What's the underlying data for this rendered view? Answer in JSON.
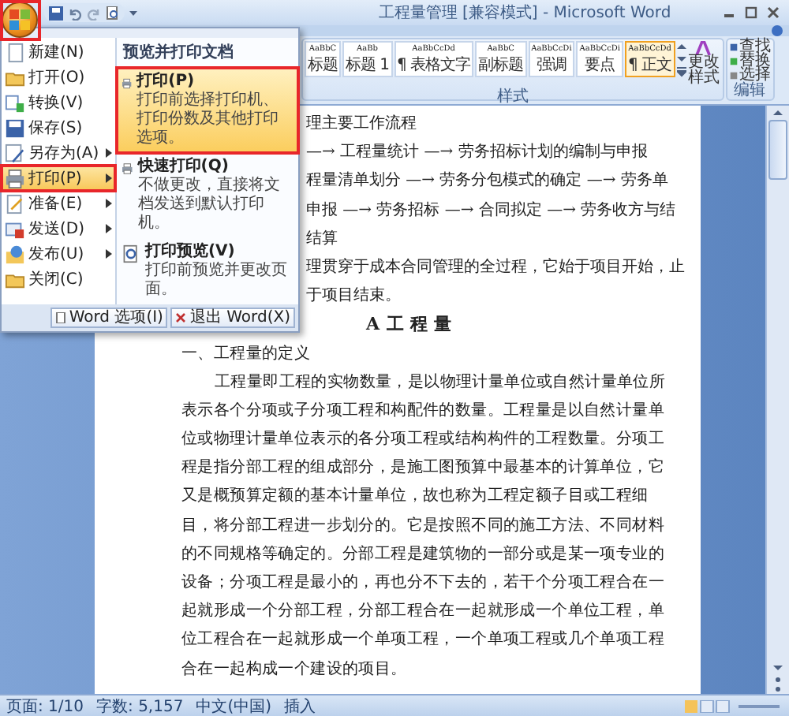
{
  "window": {
    "title": "工程量管理 [兼容模式] - Microsoft Word"
  },
  "ribbon": {
    "styles": [
      {
        "sample": "AaBbC",
        "label": "标题",
        "selected": false
      },
      {
        "sample": "AaBb",
        "label": "标题 1",
        "selected": false
      },
      {
        "sample": "AaBbCcDd",
        "label": "¶ 表格文字",
        "selected": false
      },
      {
        "sample": "AaBbC",
        "label": "副标题",
        "selected": false
      },
      {
        "sample": "AaBbCcDi",
        "label": "强调",
        "selected": false
      },
      {
        "sample": "AaBbCcDi",
        "label": "要点",
        "selected": false
      },
      {
        "sample": "AaBbCcDd",
        "label": "¶ 正文",
        "selected": true
      }
    ],
    "change_styles": "更改样式",
    "styles_group": "样式",
    "editing": [
      {
        "label": "查找"
      },
      {
        "label": "替换"
      },
      {
        "label": "选择"
      }
    ],
    "editing_group": "编辑"
  },
  "office_menu": {
    "items": [
      {
        "label": "新建(N)",
        "submenu": false,
        "selected": false
      },
      {
        "label": "打开(O)",
        "submenu": false,
        "selected": false
      },
      {
        "label": "转换(V)",
        "submenu": false,
        "selected": false
      },
      {
        "label": "保存(S)",
        "submenu": false,
        "selected": false
      },
      {
        "label": "另存为(A)",
        "submenu": true,
        "selected": false
      },
      {
        "label": "打印(P)",
        "submenu": true,
        "selected": true
      },
      {
        "label": "准备(E)",
        "submenu": true,
        "selected": false
      },
      {
        "label": "发送(D)",
        "submenu": true,
        "selected": false
      },
      {
        "label": "发布(U)",
        "submenu": true,
        "selected": false
      },
      {
        "label": "关闭(C)",
        "submenu": false,
        "selected": false
      }
    ],
    "panel": {
      "title": "预览并打印文档",
      "options": [
        {
          "label": "打印(P)",
          "description": "打印前选择打印机、打印份数及其他打印选项。",
          "selected": true
        },
        {
          "label": "快速打印(Q)",
          "description": "不做更改，直接将文档发送到默认打印机。",
          "selected": false
        },
        {
          "label": "打印预览(V)",
          "description": "打印前预览并更改页面。",
          "selected": false
        }
      ]
    },
    "footer_buttons": [
      "Word 选项(I)",
      "退出 Word(X)"
    ]
  },
  "document": {
    "flow_lines": [
      "理主要工作流程",
      "—→ 工程量统计 —→ 劳务招标计划的编制与申报",
      "程量清单划分 —→ 劳务分包模式的确定 —→ 劳务单",
      "申报 —→ 劳务招标 —→ 合同拟定 —→ 劳务收方与结",
      "结算",
      "理贯穿于成本合同管理的全过程，它始于项目开始，止",
      "于项目结束。"
    ],
    "heading": "A 工 程 量",
    "section": "一、工程量的定义",
    "paragraph_lines": [
      "工程量即工程的实物数量，是以物理计量单位或自然计量单位所",
      "表示各个分项或子分项工程和构配件的数量。工程量是以自然计量单",
      "位或物理计量单位表示的各分项工程或结构构件的工程数量。分项工",
      "程是指分部工程的组成部分，是施工图预算中最基本的计算单位，它",
      "又是概预算定额的基本计量单位，故也称为工程定额子目或工程细",
      "目，将分部工程进一步划分的。它是按照不同的施工方法、不同材料",
      "的不同规格等确定的。分部工程是建筑物的一部分或是某一项专业的",
      "设备；分项工程是最小的，再也分不下去的，若干个分项工程合在一",
      "起就形成一个分部工程，分部工程合在一起就形成一个单位工程，单",
      "位工程合在一起就形成一个单项工程，一个单项工程或几个单项工程",
      "合在一起构成一个建设的项目。"
    ]
  },
  "status_bar": [
    "页面: 1/10",
    "字数: 5,157",
    "中文(中国)",
    "插入"
  ]
}
